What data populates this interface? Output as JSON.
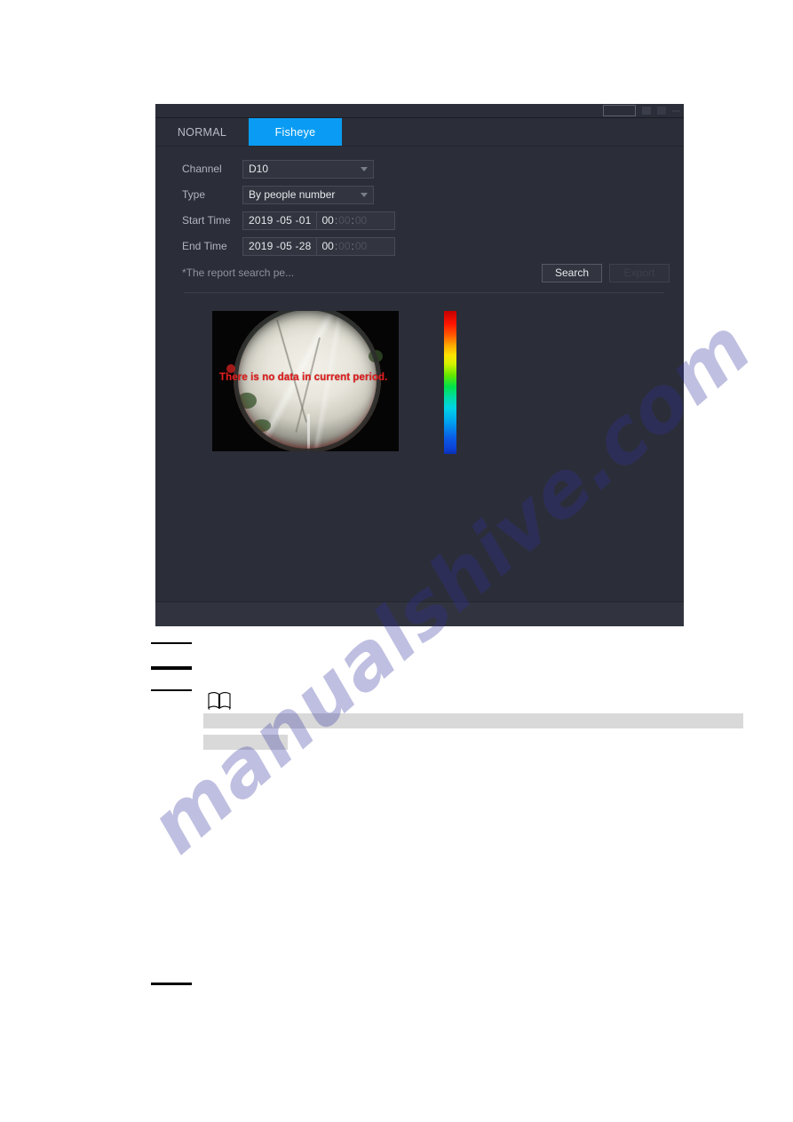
{
  "window": {
    "titlebar": {
      "restore_icon": "restore-icon",
      "minimize_icon": "minimize-icon",
      "maximize_icon": "maximize-icon",
      "close_icon": "close-icon"
    },
    "tabs": [
      {
        "label": "NORMAL",
        "active": false
      },
      {
        "label": "Fisheye",
        "active": true
      }
    ],
    "form": {
      "channel": {
        "label": "Channel",
        "value": "D10",
        "caret_icon": "chevron-down-icon"
      },
      "type": {
        "label": "Type",
        "value": "By people number",
        "caret_icon": "chevron-down-icon"
      },
      "start_time": {
        "label": "Start Time",
        "date": "2019 -05 -01",
        "hour": "00",
        "minute": "00",
        "second": "00",
        "separator": ":"
      },
      "end_time": {
        "label": "End Time",
        "date": "2019 -05 -28",
        "hour": "00",
        "minute": "00",
        "second": "00",
        "separator": ":"
      },
      "note": "*The report search pe...",
      "search_button": "Search",
      "export_button": "Export"
    },
    "result": {
      "no_data_message": "There is no data in current period.",
      "colorbar": {
        "top_color": "#c40000",
        "bottom_color": "#0a2fb4"
      }
    }
  },
  "page": {
    "watermark": "manualshive.com",
    "watermark_color": "#2f2f9e"
  },
  "colors": {
    "accent": "#0a9cf4",
    "dialog_bg": "#2b2e38",
    "field_bg": "#32353f",
    "alert_red": "#e02020"
  }
}
